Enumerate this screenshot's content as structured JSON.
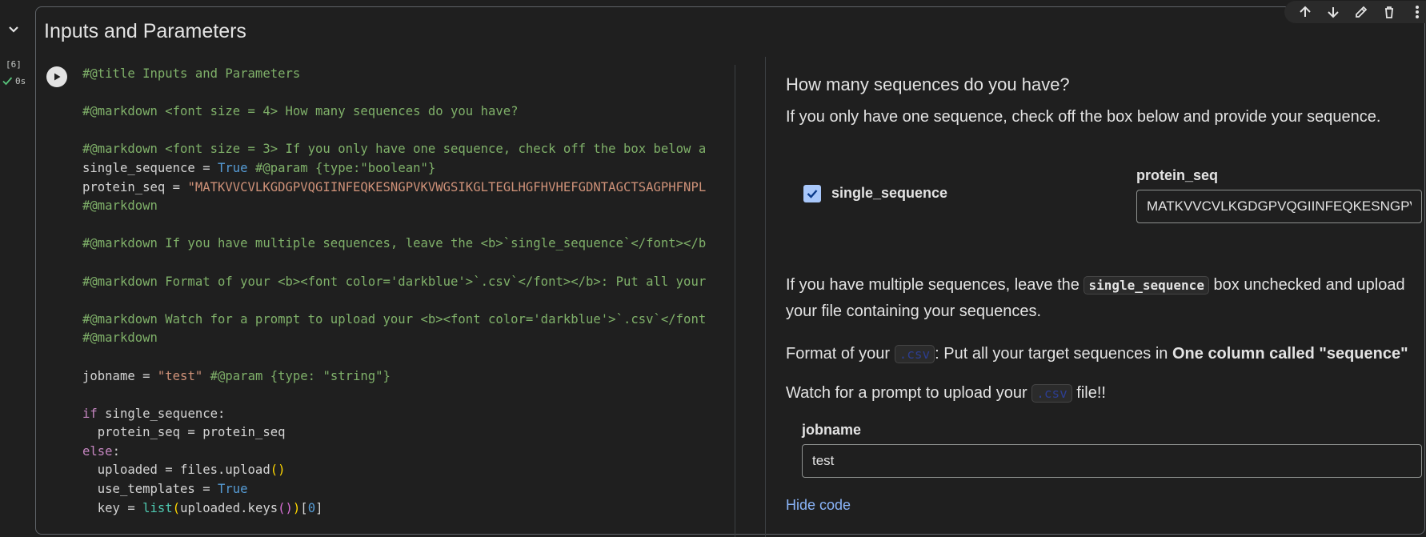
{
  "cell": {
    "title": "Inputs and Parameters",
    "execution_count": "[6]",
    "execution_time": "0s"
  },
  "code_lines": [
    [
      {
        "c": "c",
        "t": "#@title Inputs and Parameters"
      }
    ],
    [],
    [
      {
        "c": "c",
        "t": "#@markdown <font size = 4> How many sequences do you have?"
      }
    ],
    [],
    [
      {
        "c": "c",
        "t": "#@markdown <font size = 3> If you only have one sequence, check off the box below a"
      }
    ],
    [
      {
        "c": "",
        "t": "single_sequence = "
      },
      {
        "c": "kw",
        "t": "True"
      },
      {
        "c": "c",
        "t": " #@param {type:\"boolean\"}"
      }
    ],
    [
      {
        "c": "",
        "t": "protein_seq = "
      },
      {
        "c": "s",
        "t": "\"MATKVVCVLKGDGPVQGIINFEQKESNGPVKVWGSIKGLTEGLHGFHVHEFGDNTAGCTSAGPHFNPL"
      }
    ],
    [
      {
        "c": "c",
        "t": "#@markdown"
      }
    ],
    [],
    [
      {
        "c": "c",
        "t": "#@markdown If you have multiple sequences, leave the <b>`single_sequence`</font></b"
      }
    ],
    [],
    [
      {
        "c": "c",
        "t": "#@markdown Format of your <b><font color='darkblue'>`.csv`</font></b>: Put all your"
      }
    ],
    [],
    [
      {
        "c": "c",
        "t": "#@markdown Watch for a prompt to upload your <b><font color='darkblue'>`.csv`</font"
      }
    ],
    [
      {
        "c": "c",
        "t": "#@markdown"
      }
    ],
    [],
    [
      {
        "c": "",
        "t": "jobname = "
      },
      {
        "c": "s",
        "t": "\"test\""
      },
      {
        "c": "c",
        "t": " #@param {type: \"string\"}"
      }
    ],
    [],
    [
      {
        "c": "kw2",
        "t": "if"
      },
      {
        "c": "",
        "t": " single_sequence:"
      }
    ],
    [
      {
        "c": "",
        "t": "  protein_seq = protein_seq"
      }
    ],
    [
      {
        "c": "kw2",
        "t": "else"
      },
      {
        "c": "",
        "t": ":"
      }
    ],
    [
      {
        "c": "",
        "t": "  uploaded = files.upload"
      },
      {
        "c": "par",
        "t": "()"
      }
    ],
    [
      {
        "c": "",
        "t": "  use_templates = "
      },
      {
        "c": "kw",
        "t": "True"
      }
    ],
    [
      {
        "c": "",
        "t": "  key = "
      },
      {
        "c": "fn",
        "t": "list"
      },
      {
        "c": "par",
        "t": "("
      },
      {
        "c": "",
        "t": "uploaded.keys"
      },
      {
        "c": "pink",
        "t": "()"
      },
      {
        "c": "par",
        "t": ")"
      },
      {
        "c": "",
        "t": "["
      },
      {
        "c": "kw",
        "t": "0"
      },
      {
        "c": "",
        "t": "]"
      }
    ]
  ],
  "form": {
    "heading": "How many sequences do you have?",
    "single_intro": "If you only have one sequence, check off the box below and provide your sequence.",
    "single_sequence_label": "single_sequence",
    "single_sequence_checked": true,
    "protein_seq_label": "protein_seq",
    "protein_seq_value": "MATKVVCVLKGDGPVQGIINFEQKESNGPVKVWGSIKGLTEGLHGFHVHEFGDNTAGCTSAGPHFNPL",
    "multi_pre": "If you have multiple sequences, leave the ",
    "multi_code": "single_sequence",
    "multi_post": " box unchecked and upload your file containing your sequences.",
    "format_pre": "Format of your ",
    "format_code": ".csv",
    "format_mid": ": Put all your target sequences in ",
    "format_bold": "One column called \"sequence\"",
    "watch_pre": "Watch for a prompt to upload your ",
    "watch_code": ".csv",
    "watch_post": " file!!",
    "jobname_label": "jobname",
    "jobname_value": "test",
    "hide_code": "Hide code"
  },
  "icons": {
    "collapse": "chevron-down-icon",
    "run": "play-icon",
    "status": "check-icon",
    "toolbar": [
      "arrow-up-icon",
      "arrow-down-icon",
      "edit-icon",
      "trash-icon",
      "more-vert-icon"
    ]
  }
}
